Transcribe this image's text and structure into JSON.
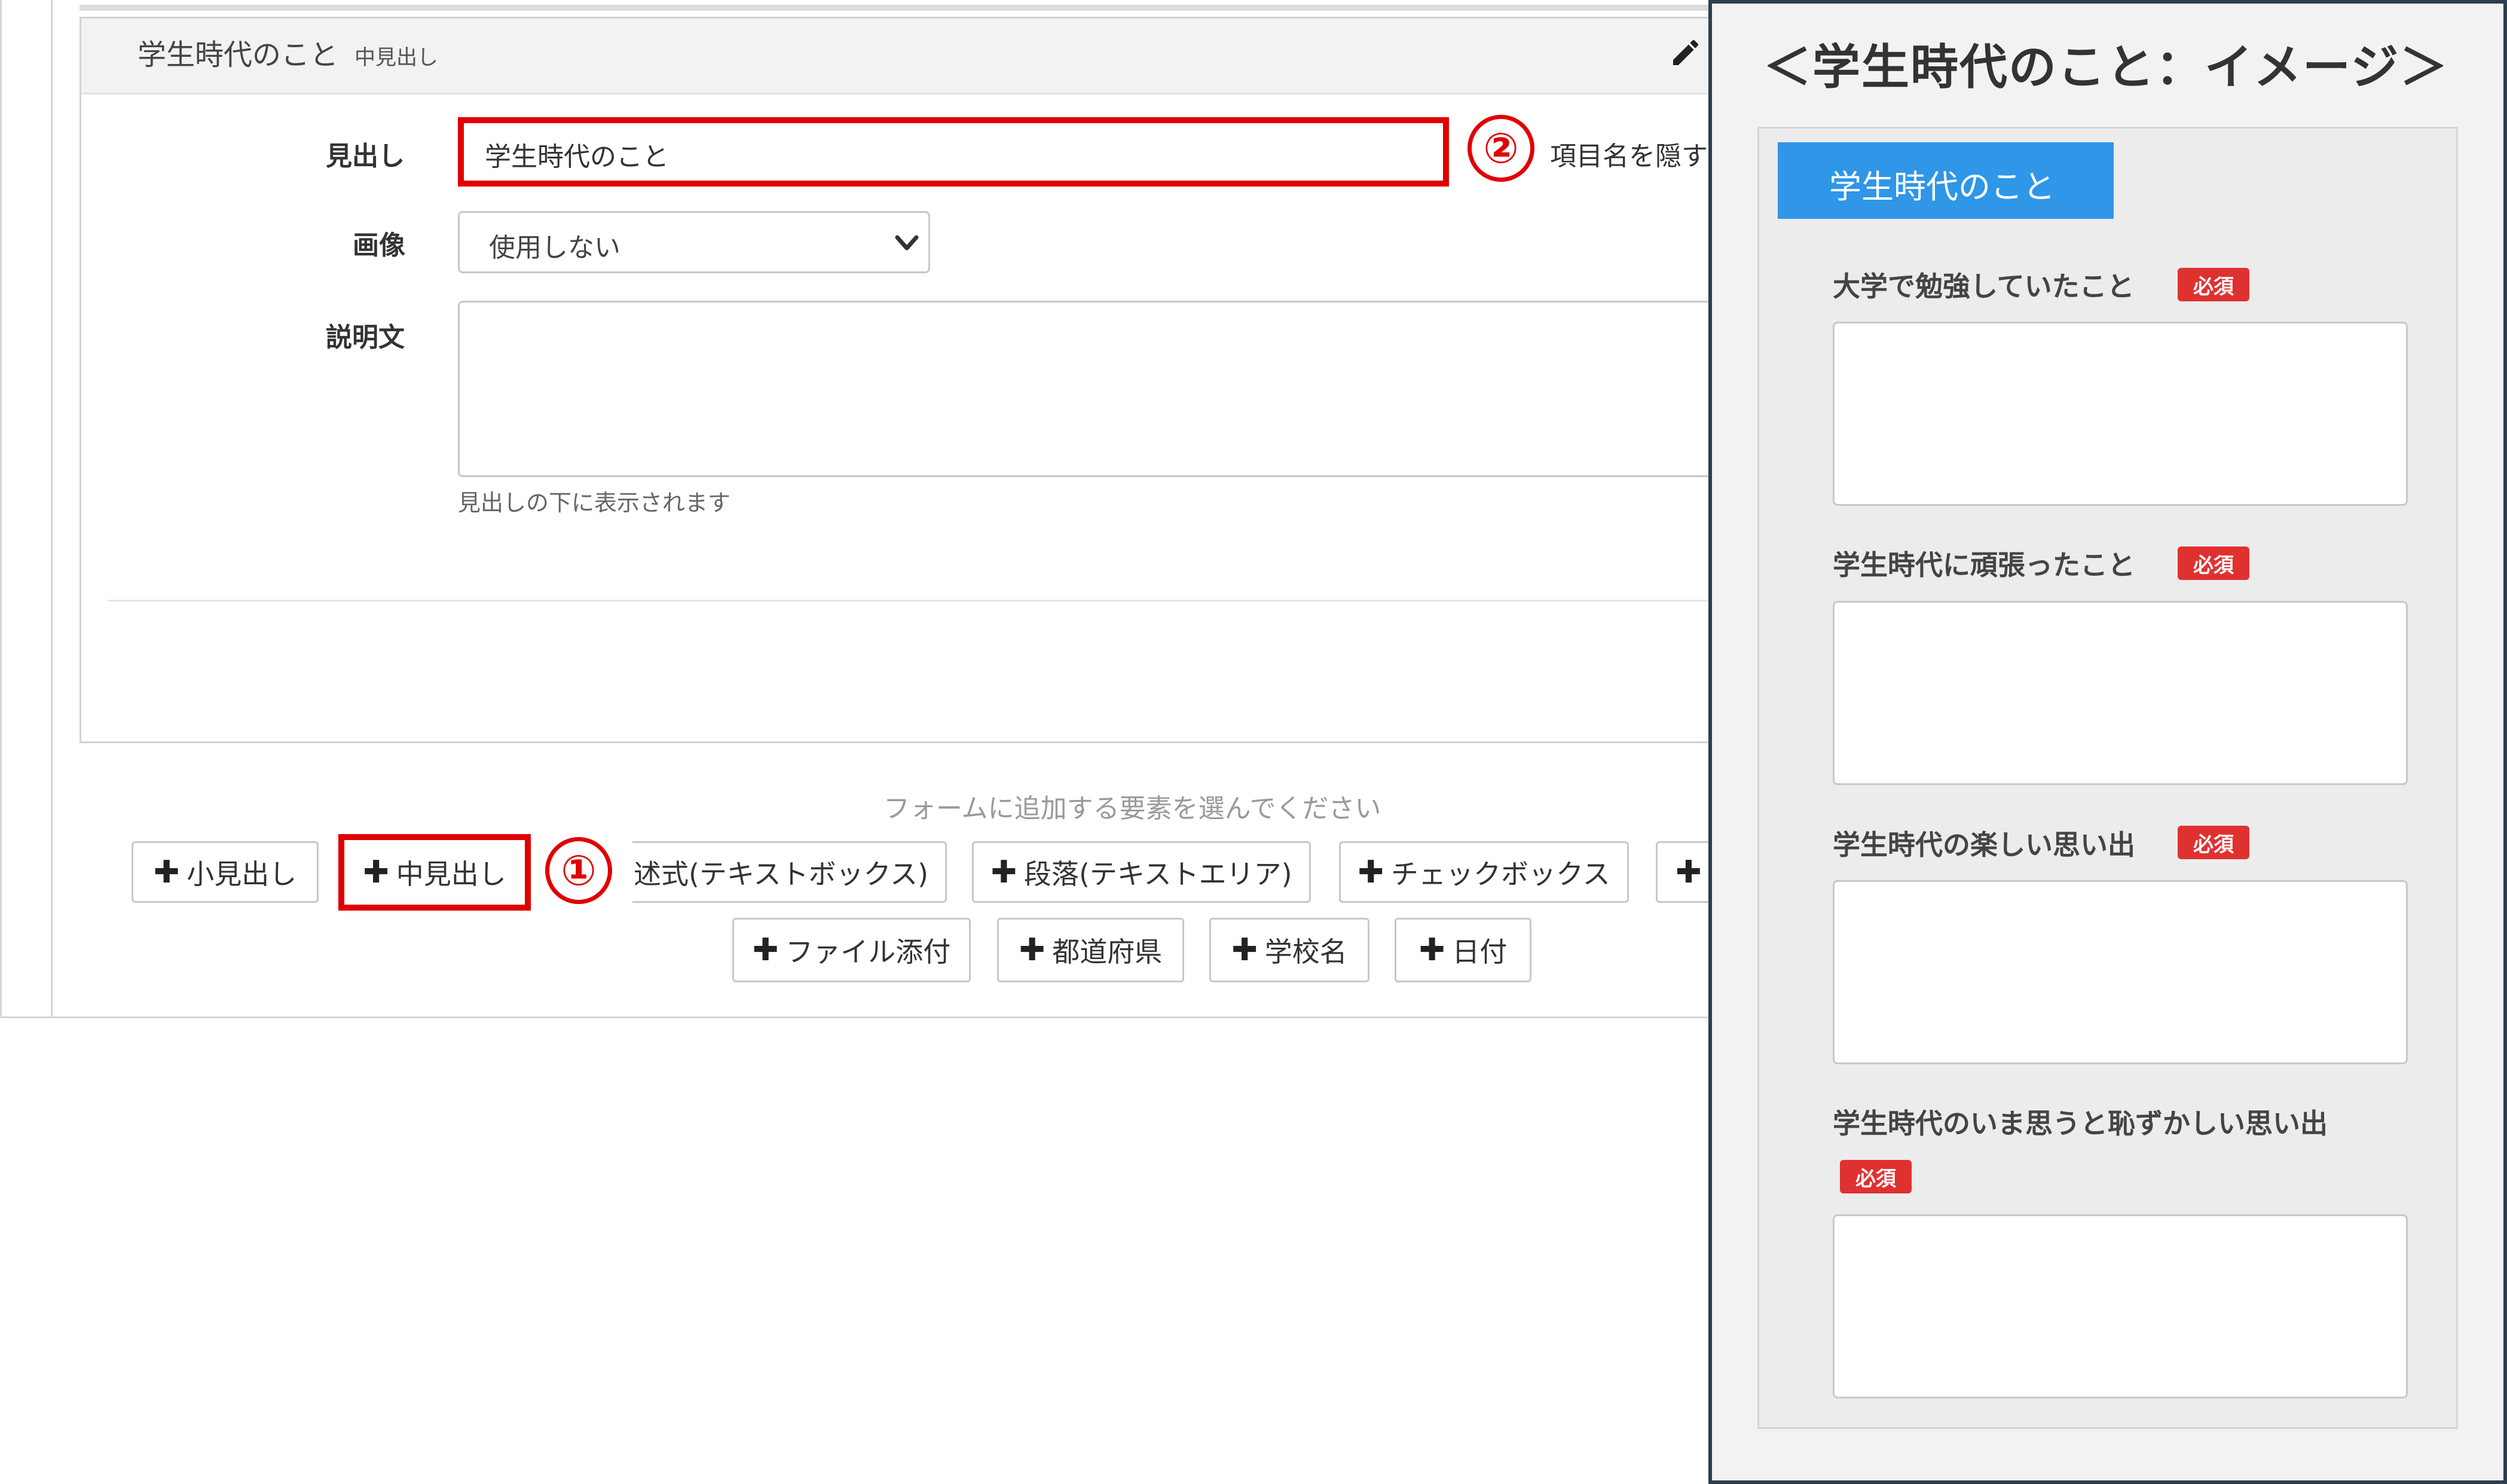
{
  "editor": {
    "card_title": "学生時代のこと",
    "card_title_sub": "中見出し",
    "labels": {
      "heading": "見出し",
      "image": "画像",
      "description": "説明文"
    },
    "heading_value": "学生時代のこと",
    "hide_label_text": "項目名を隠す",
    "image_select_value": "使用しない",
    "description_help": "見出しの下に表示されます",
    "add_prompt": "フォームに追加する要素を選んでください",
    "buttons": {
      "small_heading": "小見出し",
      "mid_heading": "中見出し",
      "textbox": "記述式(テキストボックス)",
      "textarea": "段落(テキストエリア)",
      "checkbox": "チェックボックス",
      "file": "ファイル添付",
      "prefecture": "都道府県",
      "school": "学校名",
      "date": "日付"
    },
    "plus": "✚",
    "callout_1": "①",
    "callout_2": "②"
  },
  "preview": {
    "title": "＜学生時代のこと：イメージ＞",
    "tab": "学生時代のこと",
    "required_label": "必須",
    "questions": [
      "大学で勉強していたこと",
      "学生時代に頑張ったこと",
      "学生時代の楽しい思い出",
      "学生時代のいま思うと恥ずかしい思い出"
    ]
  },
  "colors": {
    "highlight_red": "#e00000",
    "tab_blue": "#2f96e8",
    "badge_red": "#e03131",
    "panel_border": "#2c3e50"
  }
}
